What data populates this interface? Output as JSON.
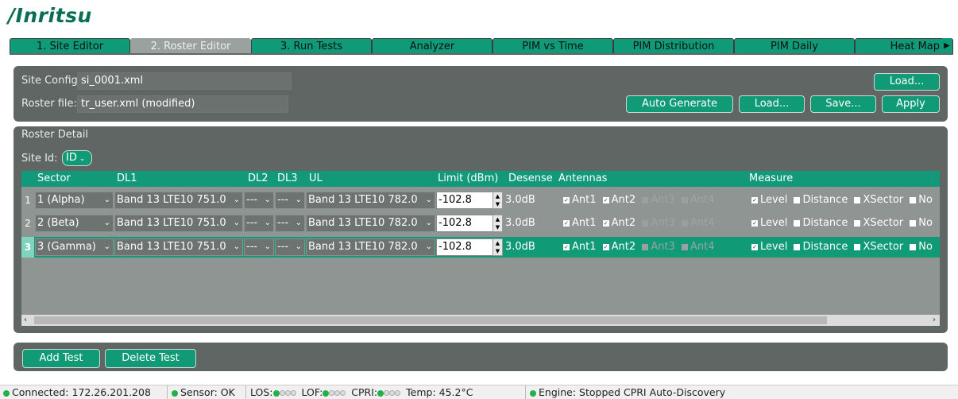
{
  "app": {
    "logo": "/Inritsu"
  },
  "tabs": [
    {
      "label": "1. Site Editor"
    },
    {
      "label": "2. Roster Editor"
    },
    {
      "label": "3. Run Tests"
    },
    {
      "label": "Analyzer"
    },
    {
      "label": "PIM vs Time"
    },
    {
      "label": "PIM Distribution"
    },
    {
      "label": "PIM Daily"
    },
    {
      "label": "Heat Map"
    }
  ],
  "config": {
    "site_label": "Site Config:",
    "site_value": "si_0001.xml",
    "roster_label": "Roster file:",
    "roster_value": "tr_user.xml (modified)",
    "load_top": "Load...",
    "auto_generate": "Auto Generate",
    "load": "Load...",
    "save": "Save...",
    "apply": "Apply"
  },
  "roster": {
    "title": "Roster Detail",
    "site_id_label": "Site Id:",
    "site_id_value": "ID",
    "headers": {
      "sector": "Sector",
      "dl1": "DL1",
      "dl2": "DL2",
      "dl3": "DL3",
      "ul": "UL",
      "limit": "Limit (dBm)",
      "desense": "Desense",
      "antennas": "Antennas",
      "measure": "Measure"
    },
    "rows": [
      {
        "num": "1",
        "sector": "1 (Alpha)",
        "dl1": "Band 13 LTE10 751.0",
        "dl2": "---",
        "dl3": "---",
        "ul": "Band 13 LTE10 782.0",
        "limit": "-102.8",
        "desense": "3.0dB",
        "ant": [
          "Ant1",
          "Ant2",
          "Ant3",
          "Ant4"
        ],
        "measure": [
          "Level",
          "Distance",
          "XSector",
          "No"
        ]
      },
      {
        "num": "2",
        "sector": "2 (Beta)",
        "dl1": "Band 13 LTE10 751.0",
        "dl2": "---",
        "dl3": "---",
        "ul": "Band 13 LTE10 782.0",
        "limit": "-102.8",
        "desense": "3.0dB",
        "ant": [
          "Ant1",
          "Ant2",
          "Ant3",
          "Ant4"
        ],
        "measure": [
          "Level",
          "Distance",
          "XSector",
          "No"
        ]
      },
      {
        "num": "3",
        "sector": "3 (Gamma)",
        "dl1": "Band 13 LTE10 751.0",
        "dl2": "---",
        "dl3": "---",
        "ul": "Band 13 LTE10 782.0",
        "limit": "-102.8",
        "desense": "3.0dB",
        "ant": [
          "Ant1",
          "Ant2",
          "Ant3",
          "Ant4"
        ],
        "measure": [
          "Level",
          "Distance",
          "XSector",
          "No"
        ]
      }
    ]
  },
  "actions": {
    "add": "Add Test",
    "delete": "Delete Test"
  },
  "status": {
    "connected": "Connected: 172.26.201.208",
    "sensor": "Sensor: OK",
    "los": "LOS:",
    "lof": "LOF:",
    "cpri": "CPRI:",
    "temp": "Temp: 45.2°C",
    "engine": "Engine: Stopped CPRI Auto-Discovery"
  },
  "colors": {
    "accent": "#109a76",
    "panel": "#5f6664",
    "logo": "#0a6e52"
  }
}
